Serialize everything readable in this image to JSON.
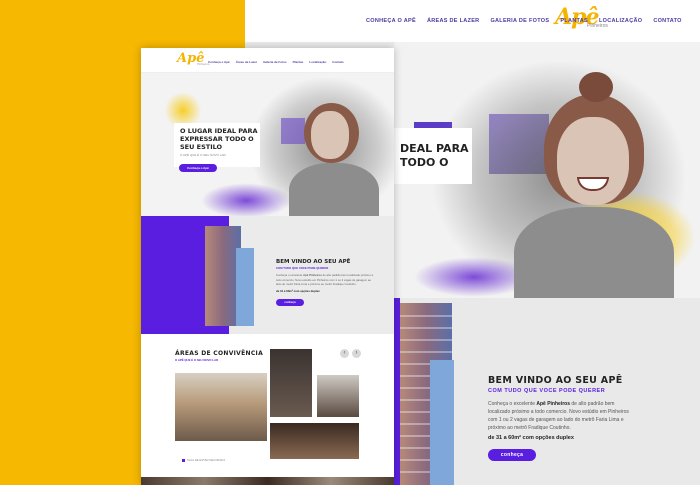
{
  "brand": {
    "name": "Apê",
    "tagline": "Pinheiros"
  },
  "nav": {
    "items": [
      "Conheça o Apê",
      "Áreas de Lazer",
      "Galeria de Fotos",
      "Plantas",
      "Localização",
      "Contato"
    ]
  },
  "hero": {
    "title_full": "O LUGAR IDEAL PARA EXPRESSAR TODO O SEU ESTILO",
    "title_line1": "O LUGAR IDEAL PARA",
    "title_line2": "EXPRESSAR TODO O",
    "title_line3": "SEU ESTILO",
    "big_crop_line1": "DEAL PARA",
    "big_crop_line2": "TODO O",
    "subtitle": "O APÊ QUE É O SEU NOVO LAR",
    "cta": "Conheça o Apê"
  },
  "welcome": {
    "title": "BEM VINDO AO SEU APÊ",
    "subtitle": "COM TUDO QUE VOCE PODE QUERER",
    "body_prefix": "Conheça o excelente ",
    "body_bold": "Apê Pinheiros",
    "body_suffix": " de alto padrão bem localizado próximo a todo comercio. Novo estúdio em Pinheiros com 1 ou 2 vagas de garagem ao lado do metrô Faria Lima e próximo ao metrô Fradique Coutinho.",
    "highlight": "de 31 a 60m² com opções duplex",
    "cta": "conheça"
  },
  "amenities": {
    "title": "ÁREAS DE CONVIVÊNCIA",
    "subtitle": "O APÊ QUE É O SEU NOVO LAR",
    "prev_icon": "chevron-left-icon",
    "next_icon": "chevron-right-icon",
    "caption": "SALA DE ESTAR DECORADA"
  },
  "colors": {
    "brand_yellow": "#f6b800",
    "accent_purple": "#5a1ee0",
    "nav_text": "#4a3aa0"
  }
}
